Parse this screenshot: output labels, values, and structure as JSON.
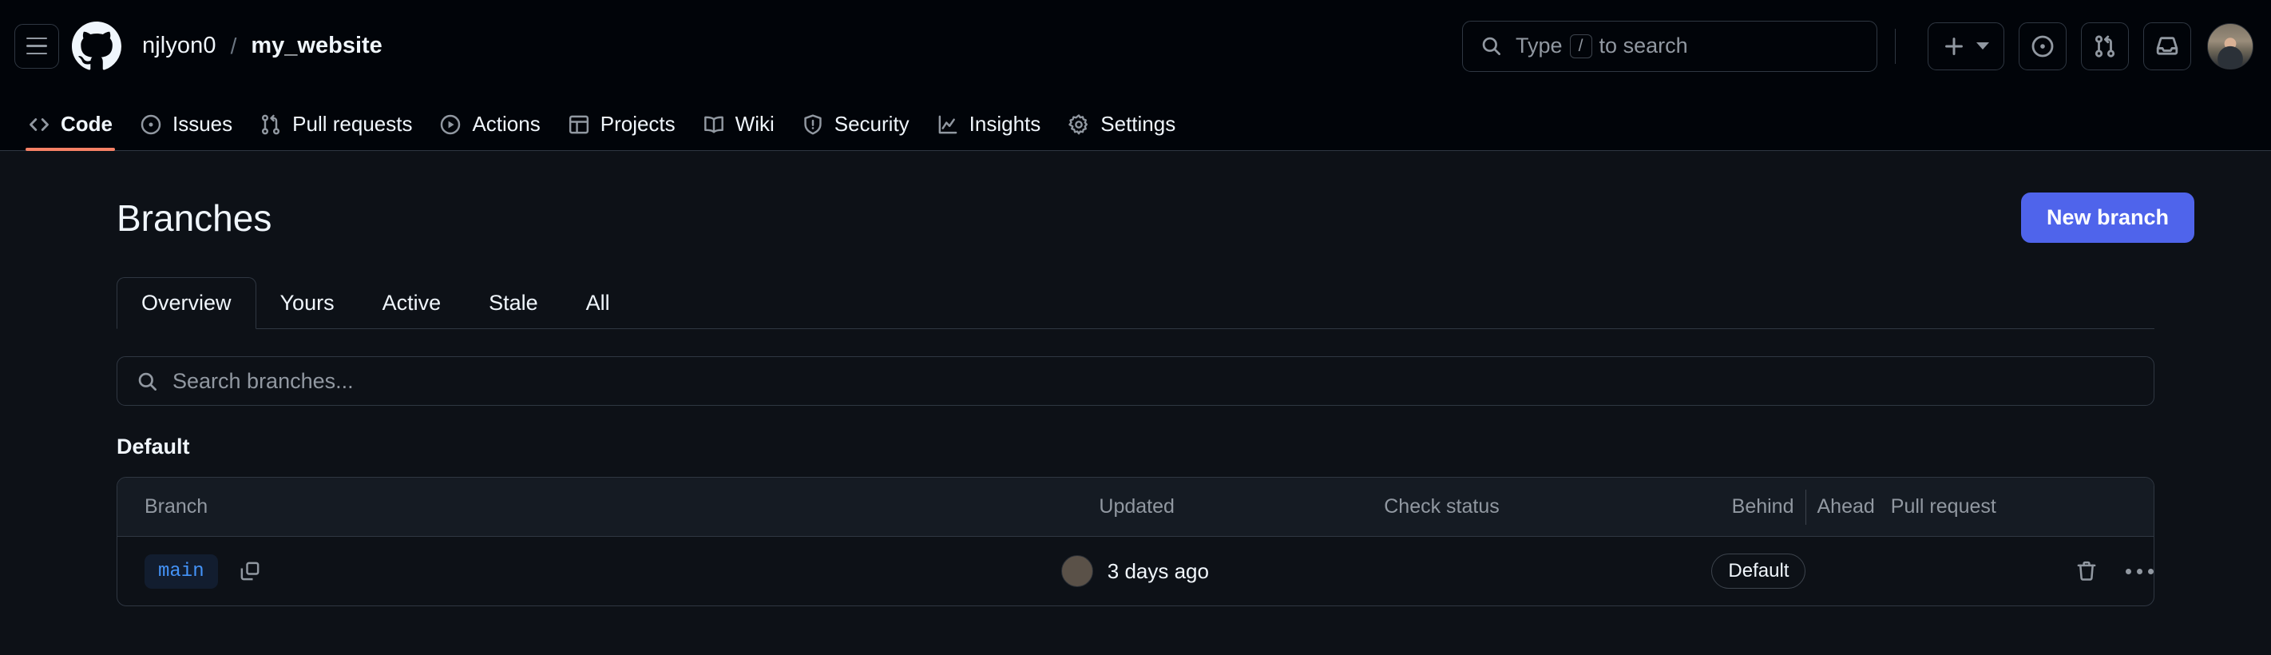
{
  "header": {
    "menu_icon": "hamburger-icon",
    "logo_icon": "github-logo-icon",
    "owner": "njlyon0",
    "separator": "/",
    "repo": "my_website",
    "search": {
      "icon": "search-icon",
      "prefix": "Type",
      "key": "/",
      "suffix": "to search"
    },
    "actions": [
      {
        "name": "create-new-menu",
        "icon": "plus-icon",
        "has_caret": true
      },
      {
        "name": "issues-button",
        "icon": "issue-opened-icon"
      },
      {
        "name": "pull-requests-button",
        "icon": "git-pull-request-icon"
      },
      {
        "name": "inbox-button",
        "icon": "inbox-icon"
      }
    ],
    "avatar": "user-avatar"
  },
  "repo_nav": [
    {
      "label": "Code",
      "icon": "code-icon",
      "active": true
    },
    {
      "label": "Issues",
      "icon": "issue-opened-icon",
      "active": false
    },
    {
      "label": "Pull requests",
      "icon": "git-pull-request-icon",
      "active": false
    },
    {
      "label": "Actions",
      "icon": "play-icon",
      "active": false
    },
    {
      "label": "Projects",
      "icon": "table-icon",
      "active": false
    },
    {
      "label": "Wiki",
      "icon": "book-icon",
      "active": false
    },
    {
      "label": "Security",
      "icon": "shield-icon",
      "active": false
    },
    {
      "label": "Insights",
      "icon": "graph-icon",
      "active": false
    },
    {
      "label": "Settings",
      "icon": "gear-icon",
      "active": false
    }
  ],
  "page": {
    "title": "Branches",
    "new_branch_label": "New branch",
    "accent_color": "#4f64eb",
    "active_tab_underline_color": "#f78166"
  },
  "tabs": [
    {
      "label": "Overview",
      "active": true
    },
    {
      "label": "Yours",
      "active": false
    },
    {
      "label": "Active",
      "active": false
    },
    {
      "label": "Stale",
      "active": false
    },
    {
      "label": "All",
      "active": false
    }
  ],
  "branch_search": {
    "icon": "search-icon",
    "placeholder": "Search branches...",
    "value": ""
  },
  "section": {
    "label": "Default"
  },
  "table": {
    "columns": {
      "branch": "Branch",
      "updated": "Updated",
      "check_status": "Check status",
      "behind": "Behind",
      "ahead": "Ahead",
      "pull_request": "Pull request"
    },
    "rows": [
      {
        "branch": "main",
        "copy_icon": "copy-icon",
        "avatar": "committer-avatar",
        "updated": "3 days ago",
        "check_status": "",
        "behind_ahead_badge": "Default",
        "pull_request": "",
        "delete_icon": "trash-icon",
        "more_icon": "kebab-horizontal-icon"
      }
    ]
  }
}
